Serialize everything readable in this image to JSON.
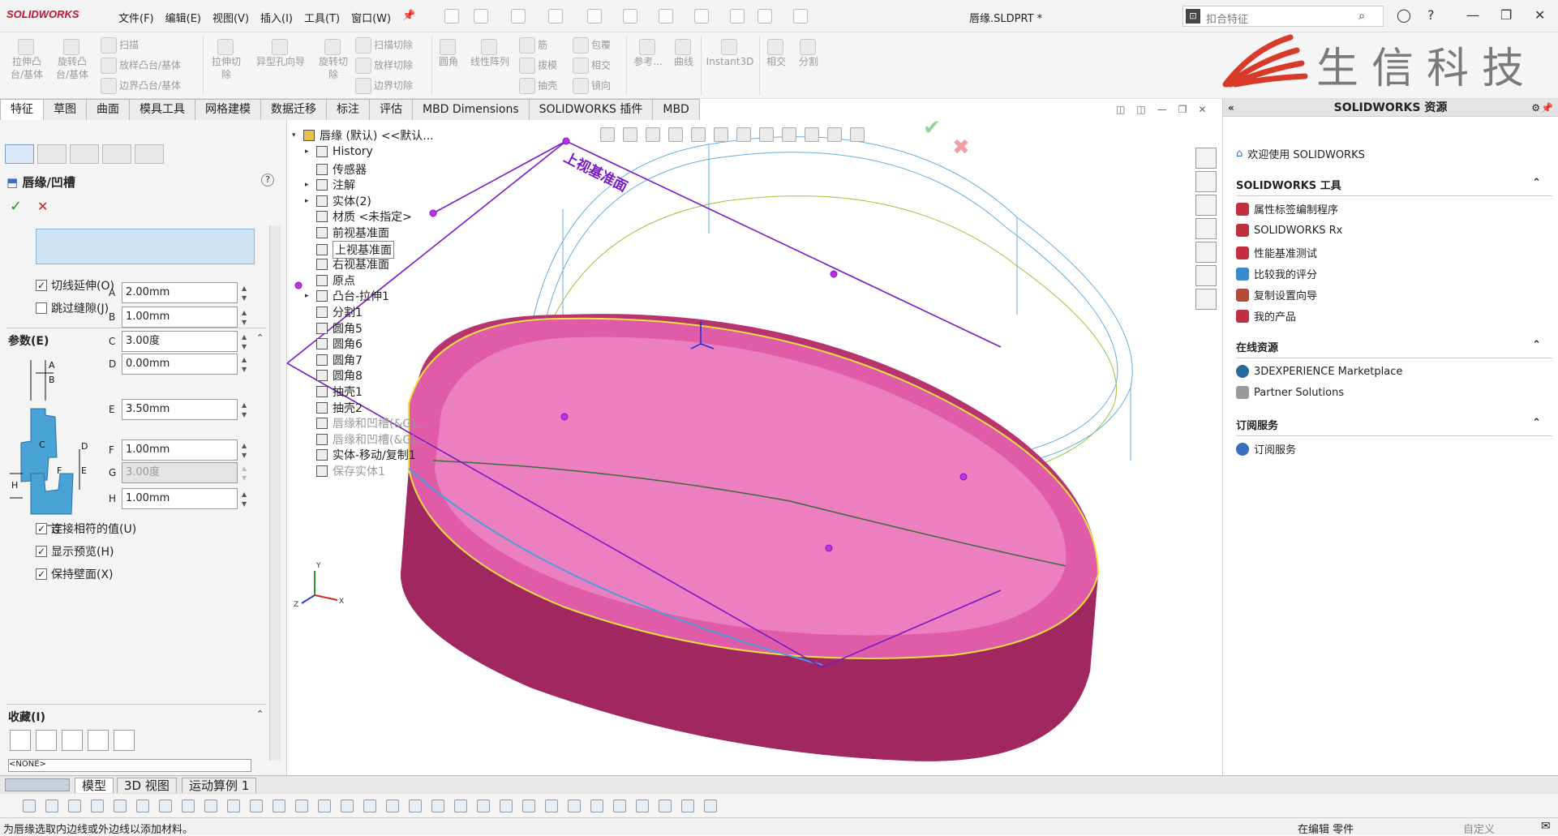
{
  "app": {
    "logo": "SOLIDWORKS",
    "doc_title": "唇缘.SLDPRT *",
    "menus": [
      "文件(F)",
      "编辑(E)",
      "视图(V)",
      "插入(I)",
      "工具(T)",
      "窗口(W)"
    ],
    "search_placeholder": "扣合特征",
    "brand_text": "生信科技"
  },
  "ribbon": {
    "tools": [
      {
        "label": "拉伸凸\n台/基体"
      },
      {
        "label": "旋转凸\n台/基体"
      },
      {
        "label": "扫描"
      },
      {
        "label": "放样凸台/基体"
      },
      {
        "label": "边界凸台/基体"
      },
      {
        "label": "拉伸切\n除"
      },
      {
        "label": "异型孔向导"
      },
      {
        "label": "旋转切\n除"
      },
      {
        "label": "扫描切除"
      },
      {
        "label": "放样切除"
      },
      {
        "label": "边界切除"
      },
      {
        "label": "圆角"
      },
      {
        "label": "线性阵列"
      },
      {
        "label": "筋"
      },
      {
        "label": "拔模"
      },
      {
        "label": "抽壳"
      },
      {
        "label": "包覆"
      },
      {
        "label": "相交"
      },
      {
        "label": "镜向"
      },
      {
        "label": "参考..."
      },
      {
        "label": "曲线"
      },
      {
        "label": "Instant3D"
      },
      {
        "label": "相交"
      },
      {
        "label": "分割"
      }
    ]
  },
  "tabs": [
    "特征",
    "草图",
    "曲面",
    "模具工具",
    "网格建模",
    "数据迁移",
    "标注",
    "评估",
    "MBD Dimensions",
    "SOLIDWORKS 插件",
    "MBD"
  ],
  "property_manager": {
    "title": "唇缘/凹槽",
    "help": "?",
    "ok": "✓",
    "cancel": "✕",
    "options": {
      "tangent_extend": "切线延伸(O)",
      "skip_gap": "跳过缝隙(J)"
    },
    "params_title": "参数(E)",
    "params": [
      {
        "label": "A",
        "value": "2.00mm"
      },
      {
        "label": "B",
        "value": "1.00mm"
      },
      {
        "label": "C",
        "value": "3.00度"
      },
      {
        "label": "D",
        "value": "0.00mm"
      },
      {
        "label": "E",
        "value": "3.50mm"
      },
      {
        "label": "F",
        "value": "1.00mm"
      },
      {
        "label": "G",
        "value": "3.00度"
      },
      {
        "label": "H",
        "value": "1.00mm"
      }
    ],
    "checks": {
      "link_values": "连接相符的值(U)",
      "show_preview": "显示预览(H)",
      "keep_wall": "保持壁面(X)"
    },
    "favorites_title": "收藏(I)",
    "favorites_value": "<NONE>"
  },
  "tree": {
    "root": "唇缘 (默认) <<默认...",
    "items": [
      {
        "label": "History",
        "state": "normal",
        "expand": true
      },
      {
        "label": "传感器",
        "state": "normal",
        "expand": false
      },
      {
        "label": "注解",
        "state": "normal",
        "expand": true
      },
      {
        "label": "实体(2)",
        "state": "normal",
        "expand": true
      },
      {
        "label": "材质 <未指定>",
        "state": "normal",
        "expand": false
      },
      {
        "label": "前视基准面",
        "state": "normal",
        "expand": false
      },
      {
        "label": "上视基准面",
        "state": "selected",
        "expand": false
      },
      {
        "label": "右视基准面",
        "state": "normal",
        "expand": false
      },
      {
        "label": "原点",
        "state": "normal",
        "expand": false
      },
      {
        "label": "凸台-拉伸1",
        "state": "normal",
        "expand": true
      },
      {
        "label": "分割1",
        "state": "normal",
        "expand": false
      },
      {
        "label": "圆角5",
        "state": "normal",
        "expand": false
      },
      {
        "label": "圆角6",
        "state": "normal",
        "expand": false
      },
      {
        "label": "圆角7",
        "state": "normal",
        "expand": false
      },
      {
        "label": "圆角8",
        "state": "normal",
        "expand": false
      },
      {
        "label": "抽壳1",
        "state": "normal",
        "expand": false
      },
      {
        "label": "抽壳2",
        "state": "normal",
        "expand": false
      },
      {
        "label": "唇缘和凹槽(&G)...",
        "state": "gray",
        "expand": false
      },
      {
        "label": "唇缘和凹槽(&G)...",
        "state": "gray",
        "expand": false
      },
      {
        "label": "实体-移动/复制1",
        "state": "normal",
        "expand": false
      },
      {
        "label": "保存实体1",
        "state": "gray",
        "expand": false
      }
    ]
  },
  "viewport": {
    "plane_label": "上视基准面",
    "axis_x": "X",
    "axis_y": "Y",
    "axis_z": "Z"
  },
  "taskpane": {
    "title": "SOLIDWORKS 资源",
    "welcome": "欢迎使用 SOLIDWORKS",
    "sections": [
      {
        "title": "SOLIDWORKS 工具",
        "items": [
          "属性标签编制程序",
          "SOLIDWORKS Rx",
          "性能基准测试",
          "比较我的评分",
          "复制设置向导",
          "我的产品"
        ]
      },
      {
        "title": "在线资源",
        "items": [
          "3DEXPERIENCE Marketplace",
          "Partner Solutions"
        ]
      },
      {
        "title": "订阅服务",
        "items": [
          "订阅服务"
        ]
      }
    ]
  },
  "bottom_tabs": [
    "模型",
    "3D 视图",
    "运动算例 1"
  ],
  "status": {
    "message": "为唇缘选取内边线或外边线以添加材料。",
    "mode": "在编辑 零件",
    "custom": "自定义"
  },
  "colors": {
    "part_pink": "#e05ca8",
    "plane_purple": "#7a18c8",
    "brand_red": "#d83a2a",
    "accent_blue": "#3a6fbf"
  }
}
